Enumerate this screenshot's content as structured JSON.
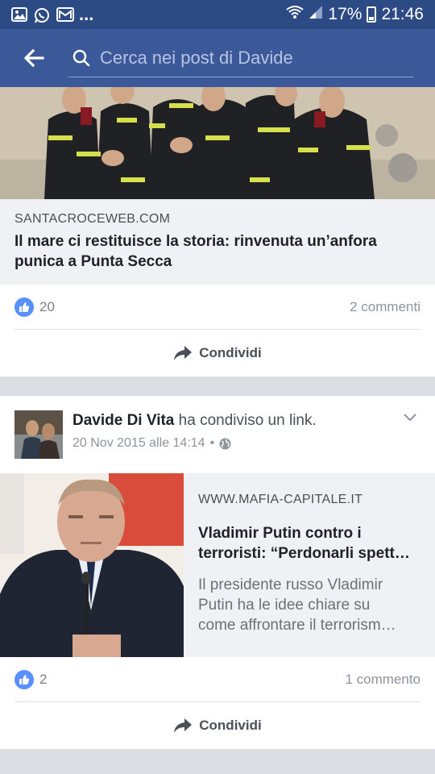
{
  "status_bar": {
    "battery": "17%",
    "time": "21:46",
    "notification_overflow": "...",
    "icons": [
      "image-icon",
      "whatsapp-icon",
      "gmail-icon",
      "wifi-icon",
      "signal-icon",
      "battery-icon"
    ]
  },
  "header": {
    "search_placeholder": "Cerca nei post di Davide",
    "back_icon": "back-arrow-icon",
    "search_icon": "search-icon",
    "bg_color": "#3b5998"
  },
  "post1": {
    "link_domain": "SANTACROCEWEB.COM",
    "link_title": "Il mare ci restituisce la storia: rinvenuta un’anfora punica a Punta Secca",
    "likes": "20",
    "comments": "2 commenti",
    "share_label": "Condividi"
  },
  "post2": {
    "author": "Davide Di Vita",
    "action": " ha condiviso un link.",
    "date": "20 Nov 2015 alle 14:14",
    "date_separator": "•",
    "link_domain": "WWW.MAFIA-CAPITALE.IT",
    "link_title_lines": [
      "Vladimir Putin contro i",
      "terroristi: “Perdonarli spett…"
    ],
    "link_desc_lines": [
      "Il presidente russo Vladimir",
      "Putin ha le idee chiare su",
      "come affrontare il terrorism…"
    ],
    "likes": "2",
    "comments": "1 commento",
    "share_label": "Condividi"
  },
  "colors": {
    "accent": "#3b5998",
    "like_blue": "#5890ff",
    "status_bar": "#2c4a84"
  }
}
